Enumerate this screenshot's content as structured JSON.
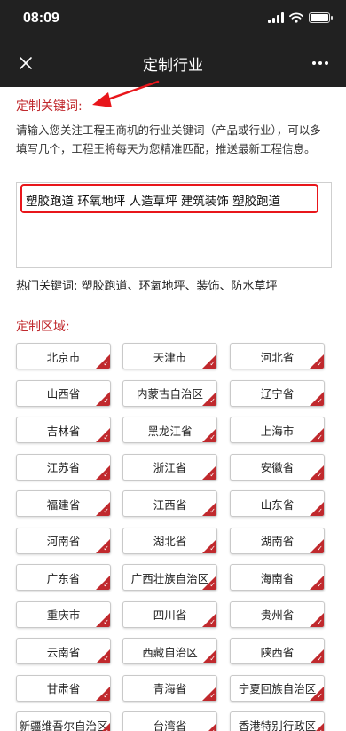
{
  "status_bar": {
    "time": "08:09"
  },
  "nav": {
    "title": "定制行业",
    "close_icon": "close-icon",
    "more_icon": "more-icon"
  },
  "keywords_section": {
    "title": "定制关键词:",
    "intro": "请输入您关注工程王商机的行业关键词（产品或行业），可以多填写几个，工程王将每天为您精准匹配，推送最新工程信息。",
    "value": "塑胶跑道 环氧地坪 人造草坪 建筑装饰 塑胶跑道",
    "hot_label": "热门关键词:",
    "hot_keywords": "塑胶跑道、环氧地坪、装饰、防水草坪"
  },
  "region_section": {
    "title": "定制区域:",
    "regions": [
      "北京市",
      "天津市",
      "河北省",
      "山西省",
      "内蒙古自治区",
      "辽宁省",
      "吉林省",
      "黑龙江省",
      "上海市",
      "江苏省",
      "浙江省",
      "安徽省",
      "福建省",
      "江西省",
      "山东省",
      "河南省",
      "湖北省",
      "湖南省",
      "广东省",
      "广西壮族自治区",
      "海南省",
      "重庆市",
      "四川省",
      "贵州省",
      "云南省",
      "西藏自治区",
      "陕西省",
      "甘肃省",
      "青海省",
      "宁夏回族自治区",
      "新疆维吾尔自治区",
      "台湾省",
      "香港特别行政区"
    ]
  },
  "colors": {
    "accent": "#c0292d",
    "highlight": "#e8161b",
    "nav_bg": "#212121"
  }
}
